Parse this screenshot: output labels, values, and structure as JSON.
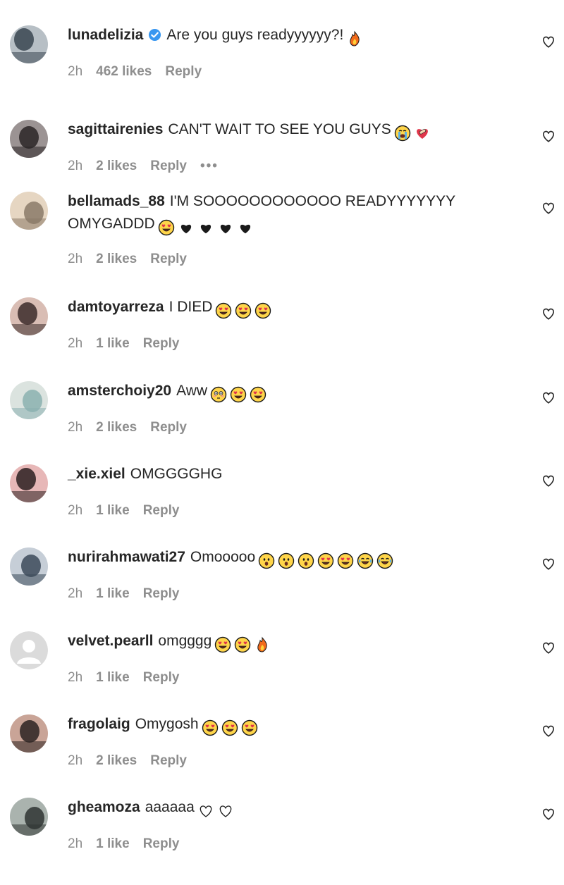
{
  "comments": [
    {
      "username": "lunadelizia",
      "verified": true,
      "text": "Are you guys readyyyyyy?!",
      "emojis": [
        "fire"
      ],
      "time": "2h",
      "likes": "462 likes",
      "reply": "Reply",
      "more": false,
      "avatar_colors": [
        "#3a4550",
        "#b7bfc5"
      ]
    },
    {
      "username": "sagittairenies",
      "verified": false,
      "text": "CAN'T WAIT TO SEE YOU GUYS",
      "emojis": [
        "loudly-crying-face",
        "heart-with-bandage"
      ],
      "time": "2h",
      "likes": "2 likes",
      "reply": "Reply",
      "more": true,
      "avatar_colors": [
        "#2a2526",
        "#9b9393"
      ]
    },
    {
      "username": "bellamads_88",
      "verified": false,
      "text": "I'M SOOOOOOOOOOOO READYYYYYYY OMYGADDD",
      "emojis": [
        "heart-eyes",
        "black-heart",
        "black-heart",
        "black-heart",
        "black-heart"
      ],
      "time": "2h",
      "likes": "2 likes",
      "reply": "Reply",
      "more": false,
      "avatar_colors": [
        "#8a7a68",
        "#e6d6c2"
      ]
    },
    {
      "username": "damtoyarreza",
      "verified": false,
      "text": "I DIED",
      "emojis": [
        "heart-eyes",
        "heart-eyes",
        "heart-eyes"
      ],
      "time": "2h",
      "likes": "1 like",
      "reply": "Reply",
      "more": false,
      "avatar_colors": [
        "#3b2b2a",
        "#d9bdb4"
      ]
    },
    {
      "username": "amsterchoiy20",
      "verified": false,
      "text": "Aww",
      "emojis": [
        "flushed-face",
        "heart-eyes",
        "heart-eyes"
      ],
      "time": "2h",
      "likes": "2 likes",
      "reply": "Reply",
      "more": false,
      "avatar_colors": [
        "#8bb1b0",
        "#dbe3df"
      ]
    },
    {
      "username": "_xie.xiel",
      "verified": false,
      "text": "OMGGGGHG",
      "emojis": [],
      "time": "2h",
      "likes": "1 like",
      "reply": "Reply",
      "more": false,
      "avatar_colors": [
        "#2b2021",
        "#e7b7b7"
      ]
    },
    {
      "username": "nurirahmawati27",
      "verified": false,
      "text": "Omooooo",
      "emojis": [
        "astonished-face",
        "astonished-face",
        "astonished-face",
        "heart-eyes",
        "heart-eyes",
        "joy-face",
        "joy-face"
      ],
      "time": "2h",
      "likes": "1 like",
      "reply": "Reply",
      "more": false,
      "avatar_colors": [
        "#3c4a5a",
        "#c6ced7"
      ]
    },
    {
      "username": "velvet.pearll",
      "verified": false,
      "text": "omgggg",
      "emojis": [
        "heart-eyes",
        "heart-eyes",
        "fire"
      ],
      "time": "2h",
      "likes": "1 like",
      "reply": "Reply",
      "more": false,
      "avatar_colors": [
        "#e0e0e0",
        "#ffffff"
      ]
    },
    {
      "username": "fragolaig",
      "verified": false,
      "text": "Omygosh",
      "emojis": [
        "heart-eyes",
        "heart-eyes",
        "heart-eyes"
      ],
      "time": "2h",
      "likes": "2 likes",
      "reply": "Reply",
      "more": false,
      "avatar_colors": [
        "#2c2321",
        "#c9a497"
      ]
    },
    {
      "username": "gheamoza",
      "verified": false,
      "text": "aaaaaa",
      "emojis": [
        "white-heart",
        "white-heart"
      ],
      "time": "2h",
      "likes": "1 like",
      "reply": "Reply",
      "more": false,
      "avatar_colors": [
        "#2f3433",
        "#aab3ae"
      ]
    }
  ],
  "colors": {
    "text": "#262626",
    "secondary": "#8e8e8e",
    "verified": "#3897f0"
  }
}
